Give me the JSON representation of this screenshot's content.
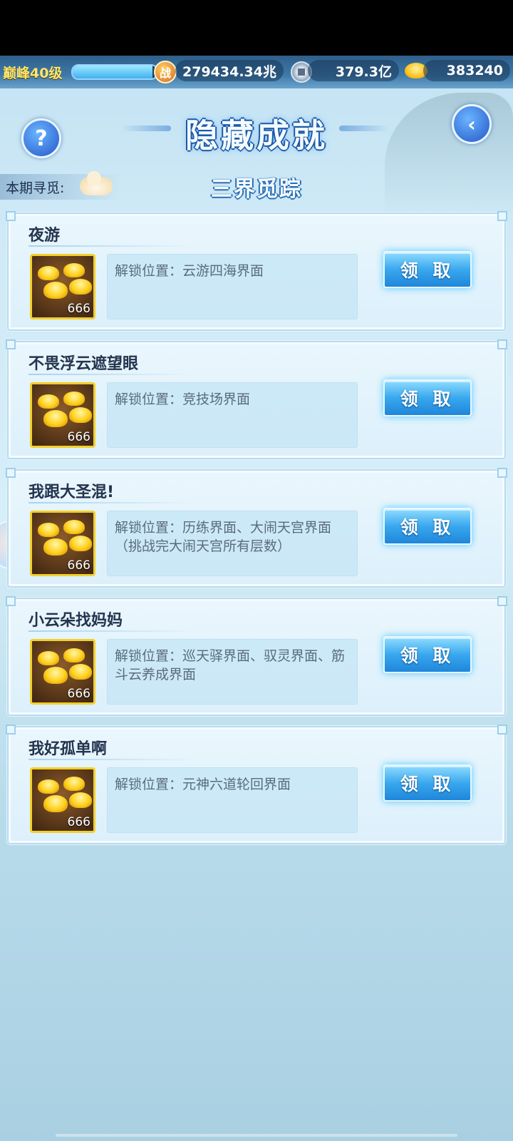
{
  "status": {
    "level": "巅峰40级",
    "xp_progress": 0.95,
    "power": "279434.34兆",
    "silver": "379.3亿",
    "gold": "383240"
  },
  "header": {
    "title": "隐藏成就",
    "period_label": "本期寻觅:",
    "subtitle": "三界觅踪"
  },
  "achievements": [
    {
      "name": "夜游",
      "reward_count": "666",
      "location": "解锁位置：云游四海界面",
      "claim_label": "领 取"
    },
    {
      "name": "不畏浮云遮望眼",
      "reward_count": "666",
      "location": "解锁位置：竞技场界面",
      "claim_label": "领 取"
    },
    {
      "name": "我跟大圣混!",
      "reward_count": "666",
      "location": "解锁位置：历练界面、大闹天宫界面（挑战完大闹天宫所有层数）",
      "claim_label": "领 取"
    },
    {
      "name": "小云朵找妈妈",
      "reward_count": "666",
      "location": "解锁位置：巡天驿界面、驭灵界面、筋斗云养成界面",
      "claim_label": "领 取"
    },
    {
      "name": "我好孤单啊",
      "reward_count": "666",
      "location": "解锁位置：元神六道轮回界面",
      "claim_label": "领 取"
    }
  ],
  "icons": {
    "help": "?",
    "back": "‹",
    "power": "战"
  }
}
